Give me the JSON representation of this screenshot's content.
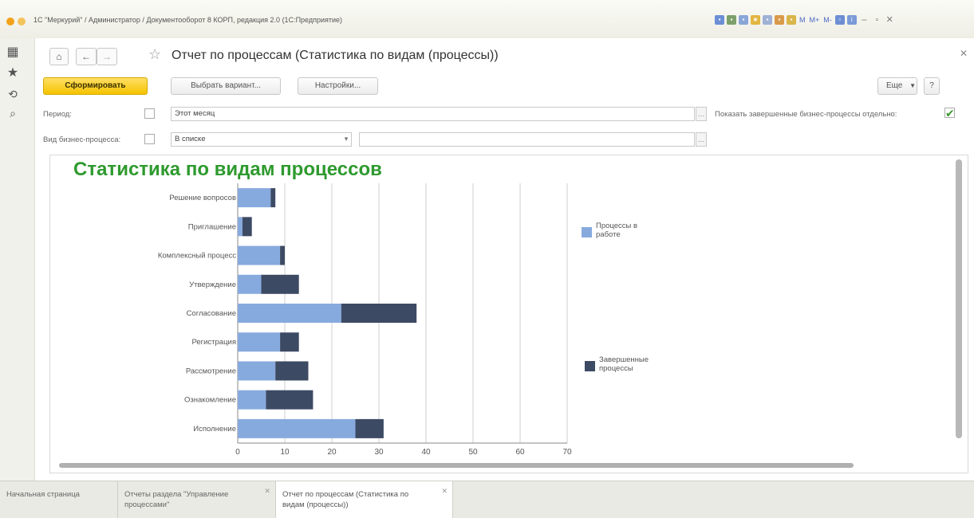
{
  "window": {
    "title": "1С \"Меркурий\" / Администратор / Документооборот 8 КОРП, редакция 2.0 (1С:Предприятие)",
    "toolbar_texts": [
      "M",
      "M+",
      "M-"
    ]
  },
  "header": {
    "title": "Отчет по процессам (Статистика по видам (процессы))"
  },
  "toolbar": {
    "generate_label": "Сформировать",
    "select_variant_label": "Выбрать вариант...",
    "settings_label": "Настройки...",
    "more_label": "Еще",
    "help_label": "?"
  },
  "filters": {
    "period_label": "Период:",
    "period_value": "Этот месяц",
    "show_completed_label": "Показать завершенные бизнес-процессы отдельно:",
    "show_completed_checked": true,
    "process_type_label": "Вид бизнес-процесса:",
    "process_type_mode": "В списке",
    "process_type_value": ""
  },
  "report": {
    "title": "Статистика по видам процессов"
  },
  "chart_data": {
    "type": "bar",
    "orientation": "horizontal",
    "stacked": true,
    "categories": [
      "Решение вопросов",
      "Приглашение",
      "Комплексный процесс",
      "Утверждение",
      "Согласование",
      "Регистрация",
      "Рассмотрение",
      "Ознакомление",
      "Исполнение"
    ],
    "series": [
      {
        "name": "Процессы в работе",
        "values": [
          7,
          1,
          9,
          5,
          22,
          9,
          8,
          6,
          25
        ],
        "color": "#87aade"
      },
      {
        "name": "Завершенные процессы",
        "values": [
          1,
          2,
          1,
          8,
          16,
          4,
          7,
          10,
          6
        ],
        "color": "#3d4a64"
      }
    ],
    "xlim": [
      0,
      70
    ],
    "xticks": [
      0,
      10,
      20,
      30,
      40,
      50,
      60,
      70
    ],
    "grid": true,
    "legend_position": "right"
  },
  "tabs": [
    {
      "label": "Начальная страница",
      "active": false
    },
    {
      "label": "Отчеты раздела \"Управление процессами\"",
      "active": false
    },
    {
      "label": "Отчет по процессам (Статистика по видам (процессы))",
      "active": true
    }
  ]
}
